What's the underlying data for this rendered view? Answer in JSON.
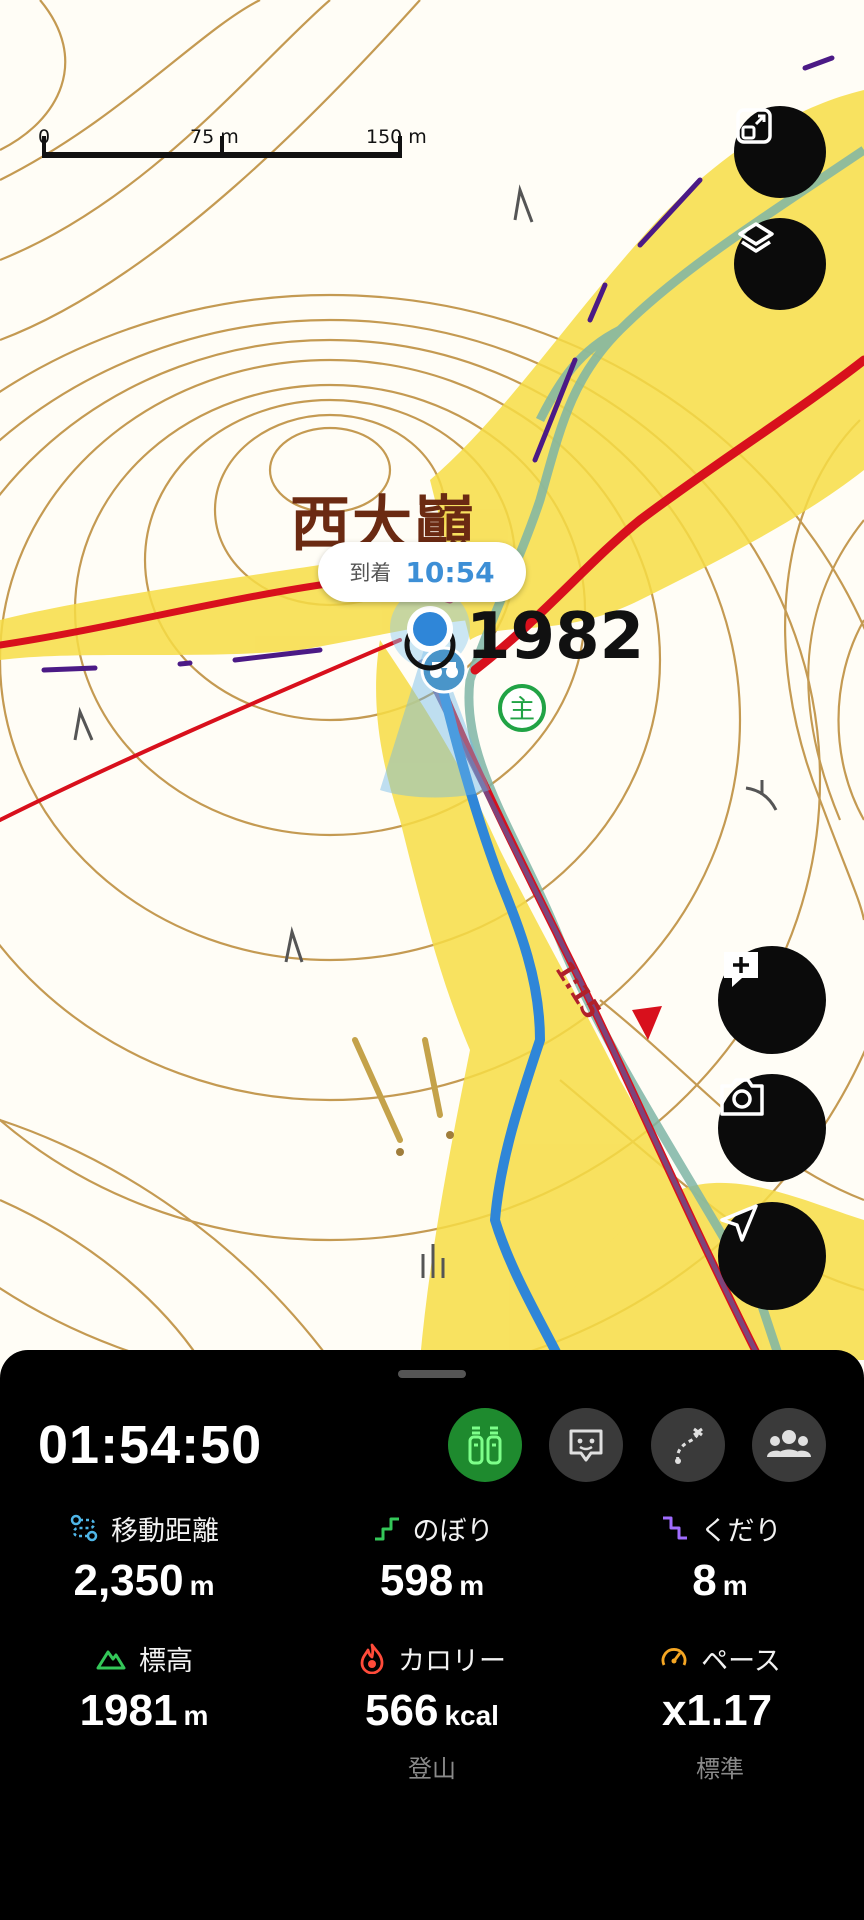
{
  "map": {
    "scale": {
      "labels": [
        "0",
        "75 m",
        "150 m"
      ]
    },
    "peak_name": "西大巓",
    "elevation_label": "1982",
    "arrival": {
      "label": "到着",
      "time": "10:54"
    },
    "pace_marker": "1:15",
    "colors": {
      "route_red": "#d8101c",
      "track_blue": "#3d8fd6",
      "heat_yellow": "#f7dd45",
      "contour": "#c49a52",
      "boundary": "#4b1a86"
    }
  },
  "map_controls": [
    {
      "name": "fullscreen-button",
      "icon": "expand-icon"
    },
    {
      "name": "layers-button",
      "icon": "layers-icon"
    },
    {
      "name": "add-note-button",
      "icon": "add-comment-icon"
    },
    {
      "name": "camera-button",
      "icon": "camera-icon"
    },
    {
      "name": "location-button",
      "icon": "navigation-arrow-icon"
    }
  ],
  "panel": {
    "elapsed_time": "01:54:50",
    "modes": [
      {
        "name": "hiking-mode",
        "icon": "hiker-icon",
        "active": true
      },
      {
        "name": "chat-mode",
        "icon": "chat-bubble-icon",
        "active": false
      },
      {
        "name": "route-mode",
        "icon": "route-icon",
        "active": false
      },
      {
        "name": "group-mode",
        "icon": "group-icon",
        "active": false
      }
    ],
    "stats": [
      {
        "label": "移動距離",
        "value": "2,350",
        "unit": "m",
        "sub": "",
        "icon_color": "#4fb6e8"
      },
      {
        "label": "のぼり",
        "value": "598",
        "unit": "m",
        "sub": "",
        "icon_color": "#34c759"
      },
      {
        "label": "くだり",
        "value": "8",
        "unit": "m",
        "sub": "",
        "icon_color": "#a06cff"
      },
      {
        "label": "標高",
        "value": "1981",
        "unit": "m",
        "sub": "",
        "icon_color": "#34c759"
      },
      {
        "label": "カロリー",
        "value": "566",
        "unit": "kcal",
        "sub": "登山",
        "icon_color": "#ff4b3a"
      },
      {
        "label": "ペース",
        "value": "x1.17",
        "unit": "",
        "sub": "標準",
        "icon_color": "#f5a623"
      }
    ]
  }
}
